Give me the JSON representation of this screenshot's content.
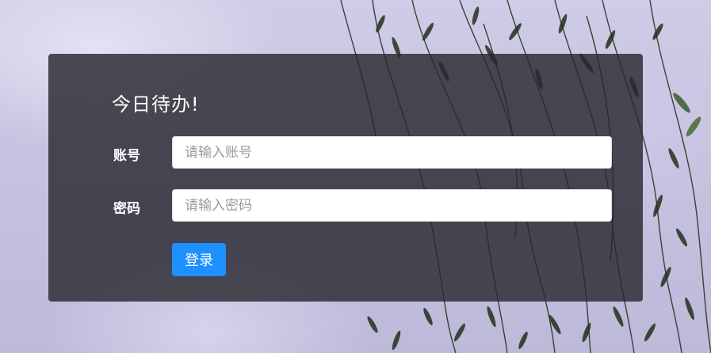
{
  "login": {
    "title": "今日待办!",
    "account_label": "账号",
    "account_placeholder": "请输入账号",
    "password_label": "密码",
    "password_placeholder": "请输入密码",
    "submit_label": "登录"
  },
  "colors": {
    "panel": "#28283099",
    "accent": "#1e90ff",
    "sky": "#c6c2e0",
    "foliage": "#24301f"
  }
}
